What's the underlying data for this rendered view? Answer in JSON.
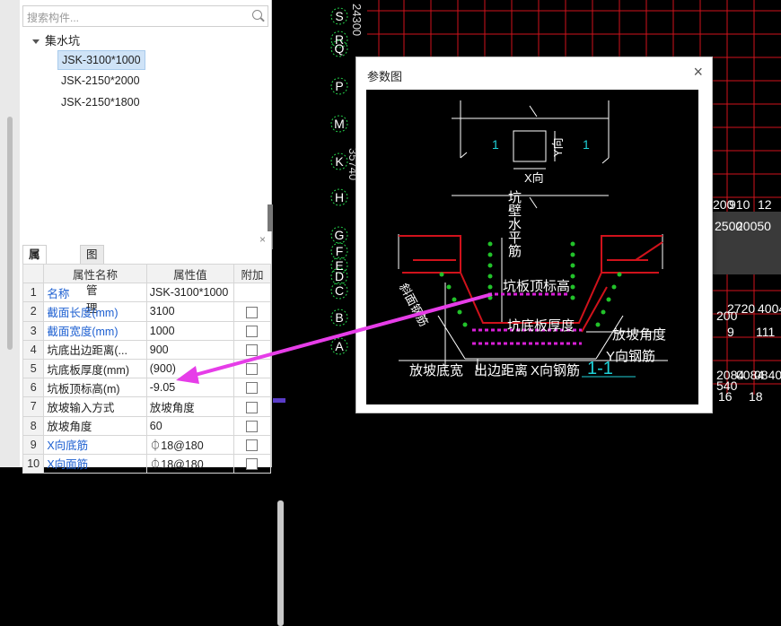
{
  "search": {
    "placeholder": "搜索构件..."
  },
  "tree": {
    "root": "集水坑",
    "items": [
      "JSK-3100*1000",
      "JSK-2150*2000",
      "JSK-2150*1800"
    ]
  },
  "properties": {
    "tabs": [
      "属性列表",
      "图层管理"
    ],
    "close": "×",
    "headers": {
      "name": "属性名称",
      "value": "属性值",
      "extra": "附加"
    },
    "rows": [
      {
        "num": "1",
        "name": "名称",
        "value": "JSK-3100*1000",
        "blue": true,
        "check": false
      },
      {
        "num": "2",
        "name": "截面长度(mm)",
        "value": "3100",
        "blue": true,
        "check": true
      },
      {
        "num": "3",
        "name": "截面宽度(mm)",
        "value": "1000",
        "blue": true,
        "check": true
      },
      {
        "num": "4",
        "name": "坑底出边距离(...",
        "value": "900",
        "blue": false,
        "check": true
      },
      {
        "num": "5",
        "name": "坑底板厚度(mm)",
        "value": "(900)",
        "blue": false,
        "check": true
      },
      {
        "num": "6",
        "name": "坑板顶标高(m)",
        "value": "-9.05",
        "blue": false,
        "check": true
      },
      {
        "num": "7",
        "name": "放坡输入方式",
        "value": "放坡角度",
        "blue": false,
        "check": true
      },
      {
        "num": "8",
        "name": "放坡角度",
        "value": "60",
        "blue": false,
        "check": true
      },
      {
        "num": "9",
        "name": "X向底筋",
        "value": "⏀18@180",
        "blue": true,
        "check": true
      },
      {
        "num": "10",
        "name": "X向面筋",
        "value": "⏀18@180",
        "blue": true,
        "check": true
      }
    ]
  },
  "modal": {
    "title": "参数图",
    "close": "×",
    "labels": {
      "sec_left": "1",
      "sec_right": "1",
      "y_dir": "Y向",
      "x_dir": "X向",
      "wall_rebar": "坑壁水平筋",
      "top_elev": "坑板顶标高",
      "slope_rebar": "斜面钢筋",
      "bottom_thick": "坑底板厚度",
      "slope_angle": "放坡角度",
      "y_rebar": "Y向钢筋",
      "slope_width": "放坡底宽",
      "edge_dist": "出边距离",
      "x_rebar": "X向钢筋",
      "section": "1-1"
    }
  },
  "cad": {
    "axis_letters": [
      "S",
      "R",
      "Q",
      "P",
      "M",
      "K",
      "H",
      "G",
      "F",
      "E",
      "D",
      "C",
      "B",
      "A"
    ],
    "vertical_texts": [
      "24300",
      "35740"
    ],
    "right_labels": [
      "200",
      "910",
      "12",
      "2500",
      "20050",
      "200",
      "2720",
      "4004",
      "9",
      "111",
      "2084",
      "0084",
      "0840",
      "540",
      "16",
      "18"
    ]
  }
}
